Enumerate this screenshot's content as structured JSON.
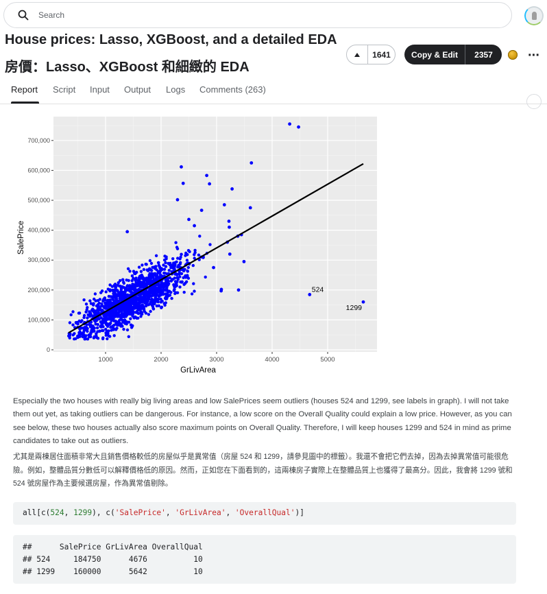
{
  "search": {
    "placeholder": "Search"
  },
  "title": {
    "en": "House prices: Lasso, XGBoost, and a detailed EDA",
    "zh": "房價：Lasso、XGBoost 和細緻的 EDA"
  },
  "actions": {
    "upvotes": "1641",
    "copy_edit_label": "Copy & Edit",
    "copy_edit_count": "2357"
  },
  "tabs": [
    {
      "label": "Report"
    },
    {
      "label": "Script"
    },
    {
      "label": "Input"
    },
    {
      "label": "Output"
    },
    {
      "label": "Logs"
    },
    {
      "label": "Comments (263)"
    }
  ],
  "chart_data": {
    "type": "scatter",
    "xlabel": "GrLivArea",
    "ylabel": "SalePrice",
    "xlim": [
      0,
      6000
    ],
    "ylim": [
      0,
      800000
    ],
    "xticks": [
      1000,
      2000,
      3000,
      4000,
      5000
    ],
    "yticks": [
      0,
      100000,
      200000,
      300000,
      400000,
      500000,
      600000,
      700000
    ],
    "ytick_labels": [
      "0",
      "100,000",
      "200,000",
      "300,000",
      "400,000",
      "500,000",
      "600,000",
      "700,000"
    ],
    "point_color": "#0000ff",
    "regression_line": {
      "x": [
        334,
        5642
      ],
      "y": [
        57000,
        622000
      ]
    },
    "annotations": [
      {
        "label": "524",
        "x": 4676,
        "y": 184750
      },
      {
        "label": "1299",
        "x": 5642,
        "y": 160000
      }
    ],
    "outlier_points": [
      {
        "x": 4316,
        "y": 755000
      },
      {
        "x": 4476,
        "y": 745000
      },
      {
        "x": 3627,
        "y": 625000
      },
      {
        "x": 2364,
        "y": 611657
      },
      {
        "x": 2822,
        "y": 582933
      },
      {
        "x": 2872,
        "y": 555000
      },
      {
        "x": 3279,
        "y": 538000
      },
      {
        "x": 2398,
        "y": 556581
      },
      {
        "x": 2296,
        "y": 501837
      },
      {
        "x": 3140,
        "y": 485000
      },
      {
        "x": 3608,
        "y": 475000
      },
      {
        "x": 2730,
        "y": 466500
      },
      {
        "x": 3222,
        "y": 430000
      },
      {
        "x": 3228,
        "y": 410000
      },
      {
        "x": 3447,
        "y": 385000
      },
      {
        "x": 3382,
        "y": 380000
      },
      {
        "x": 3194,
        "y": 360000
      },
      {
        "x": 3238,
        "y": 320000
      },
      {
        "x": 3493,
        "y": 295000
      },
      {
        "x": 3086,
        "y": 202000
      },
      {
        "x": 3395,
        "y": 200000
      },
      {
        "x": 3082,
        "y": 197000
      },
      {
        "x": 2945,
        "y": 275000
      },
      {
        "x": 1391,
        "y": 395000
      },
      {
        "x": 2500,
        "y": 436000
      },
      {
        "x": 2600,
        "y": 415000
      }
    ],
    "points_total": 1460
  },
  "text": {
    "para_en": "Especially the two houses with really big living areas and low SalePrices seem outliers (houses 524 and 1299, see labels in graph). I will not take them out yet, as taking outliers can be dangerous. For instance, a low score on the Overall Quality could explain a low price. However, as you can see below, these two houses actually also score maximum points on Overall Quality. Therefore, I will keep houses 1299 and 524 in mind as prime candidates to take out as outliers.",
    "para_zh": "尤其是兩棟居住面積非常大且銷售價格較低的房屋似乎是異常值（房屋 524 和 1299，請參見圖中的標籤）。我還不會把它們去掉，因為去掉異常值可能很危險。例如，整體品質分數低可以解釋價格低的原因。然而，正如您在下面看到的，這兩棟房子實際上在整體品質上也獲得了最高分。因此，我會將 1299 號和 524 號房屋作為主要候選房屋，作為異常值剔除。"
  },
  "code": {
    "input_prefix": "all[c(",
    "input_n1": "524",
    "input_sep1": ", ",
    "input_n2": "1299",
    "input_mid": "), c(",
    "input_s1": "'SalePrice'",
    "input_sep2": ", ",
    "input_s2": "'GrLivArea'",
    "input_sep3": ", ",
    "input_s3": "'OverallQual'",
    "input_suffix": ")]",
    "output_lines": [
      "##      SalePrice GrLivArea OverallQual",
      "## 524     184750      4676          10",
      "## 1299    160000      5642          10"
    ]
  },
  "colors": {
    "brand_dark": "#202124",
    "chart_panel": "#ebebeb",
    "point": "#0000ff"
  }
}
